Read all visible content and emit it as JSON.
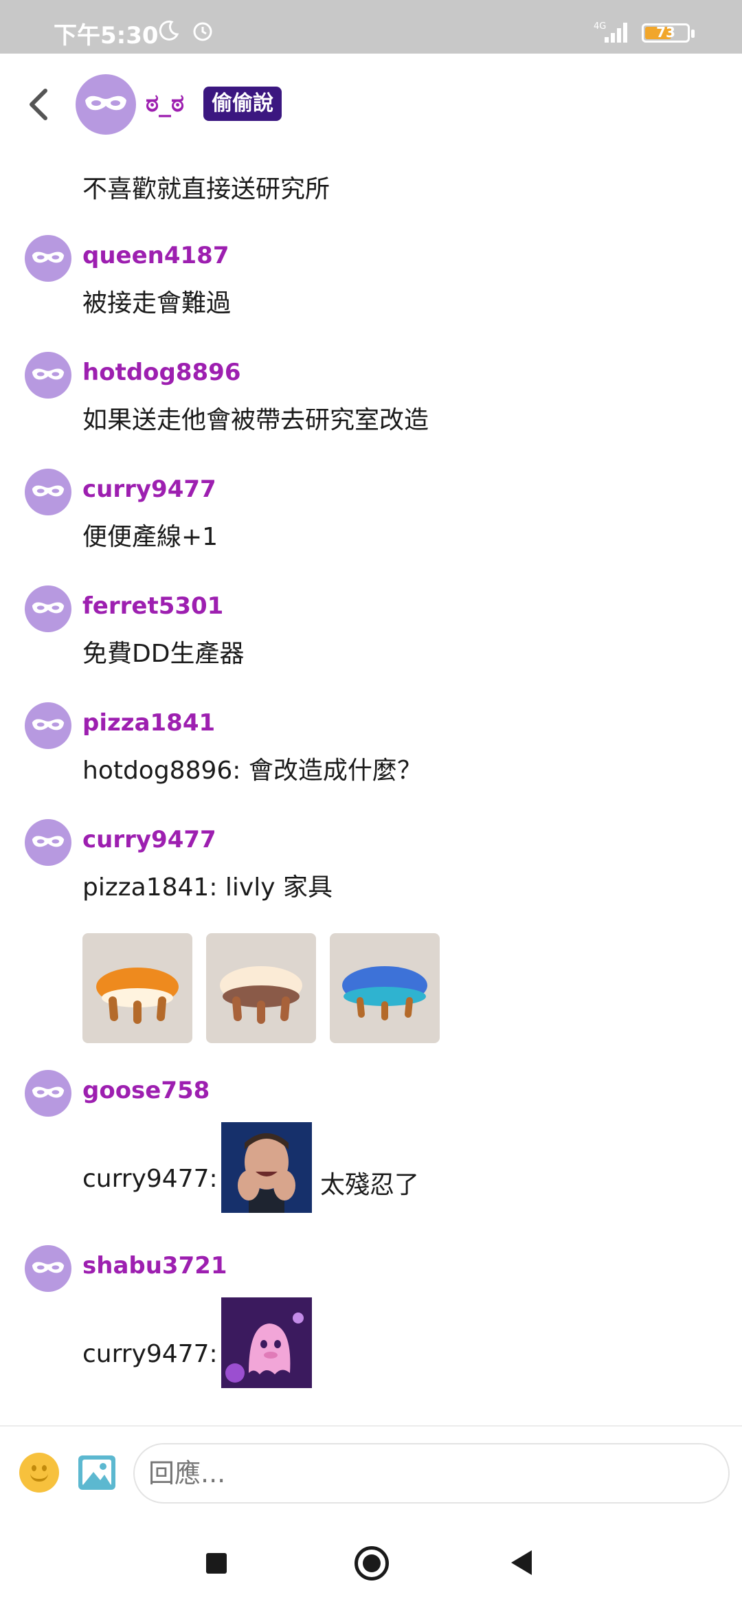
{
  "status_bar": {
    "time": "下午5:30",
    "network": "4G",
    "battery": "73"
  },
  "header": {
    "title": "ಠ_ಠ",
    "badge": "偷偷說"
  },
  "post": {
    "text": "不喜歡就直接送研究所"
  },
  "comments": [
    {
      "username": "queen4187",
      "text": "被接走會難過"
    },
    {
      "username": "hotdog8896",
      "text": "如果送走他會被帶去研究室改造"
    },
    {
      "username": "curry9477",
      "text": "便便產線+1"
    },
    {
      "username": "ferret5301",
      "text": "免費DD生產器"
    },
    {
      "username": "pizza1841",
      "text": "hotdog8896: 會改造成什麼？"
    },
    {
      "username": "curry9477",
      "text": "pizza1841: livly 家具",
      "images": [
        "orange-stool-image",
        "white-stool-image",
        "blue-stool-image"
      ]
    },
    {
      "username": "goose758",
      "reply_to": "curry9477:",
      "sticker": "crying-man-sticker",
      "after_text": "太殘忍了"
    },
    {
      "username": "shabu3721",
      "reply_to": "curry9477:",
      "sticker": "pink-ghost-sticker"
    }
  ],
  "reply_bar": {
    "placeholder": "回應..."
  },
  "colors": {
    "username": "#9d1fb0",
    "avatar": "#b799e0",
    "badge": "#3b1780"
  }
}
